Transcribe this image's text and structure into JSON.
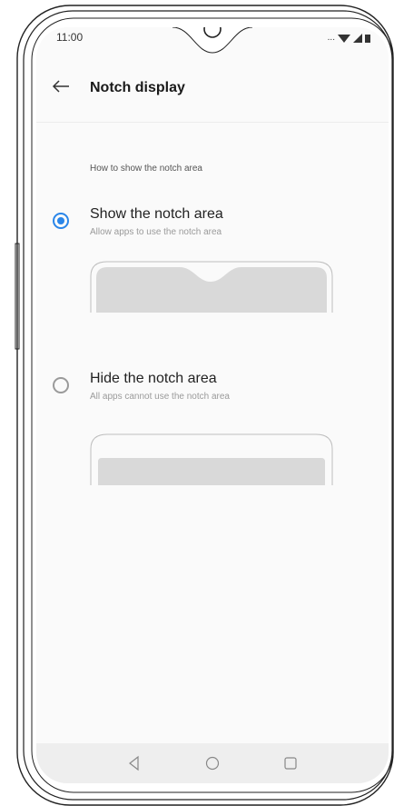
{
  "status_bar": {
    "time": "11:00",
    "indicators": "..."
  },
  "header": {
    "title": "Notch display",
    "back_icon": "arrow-left-icon"
  },
  "section": {
    "label": "How to show the notch area"
  },
  "options": [
    {
      "title": "Show the notch area",
      "subtitle": "Allow apps to use the notch area",
      "selected": true
    },
    {
      "title": "Hide the notch area",
      "subtitle": "All apps cannot use the notch area",
      "selected": false
    }
  ],
  "nav_bar": {
    "buttons": [
      "back-triangle-icon",
      "home-circle-icon",
      "recents-square-icon"
    ]
  },
  "colors": {
    "accent": "#2a86e9",
    "background": "#fafafa",
    "nav_bar": "#eeeeee"
  }
}
